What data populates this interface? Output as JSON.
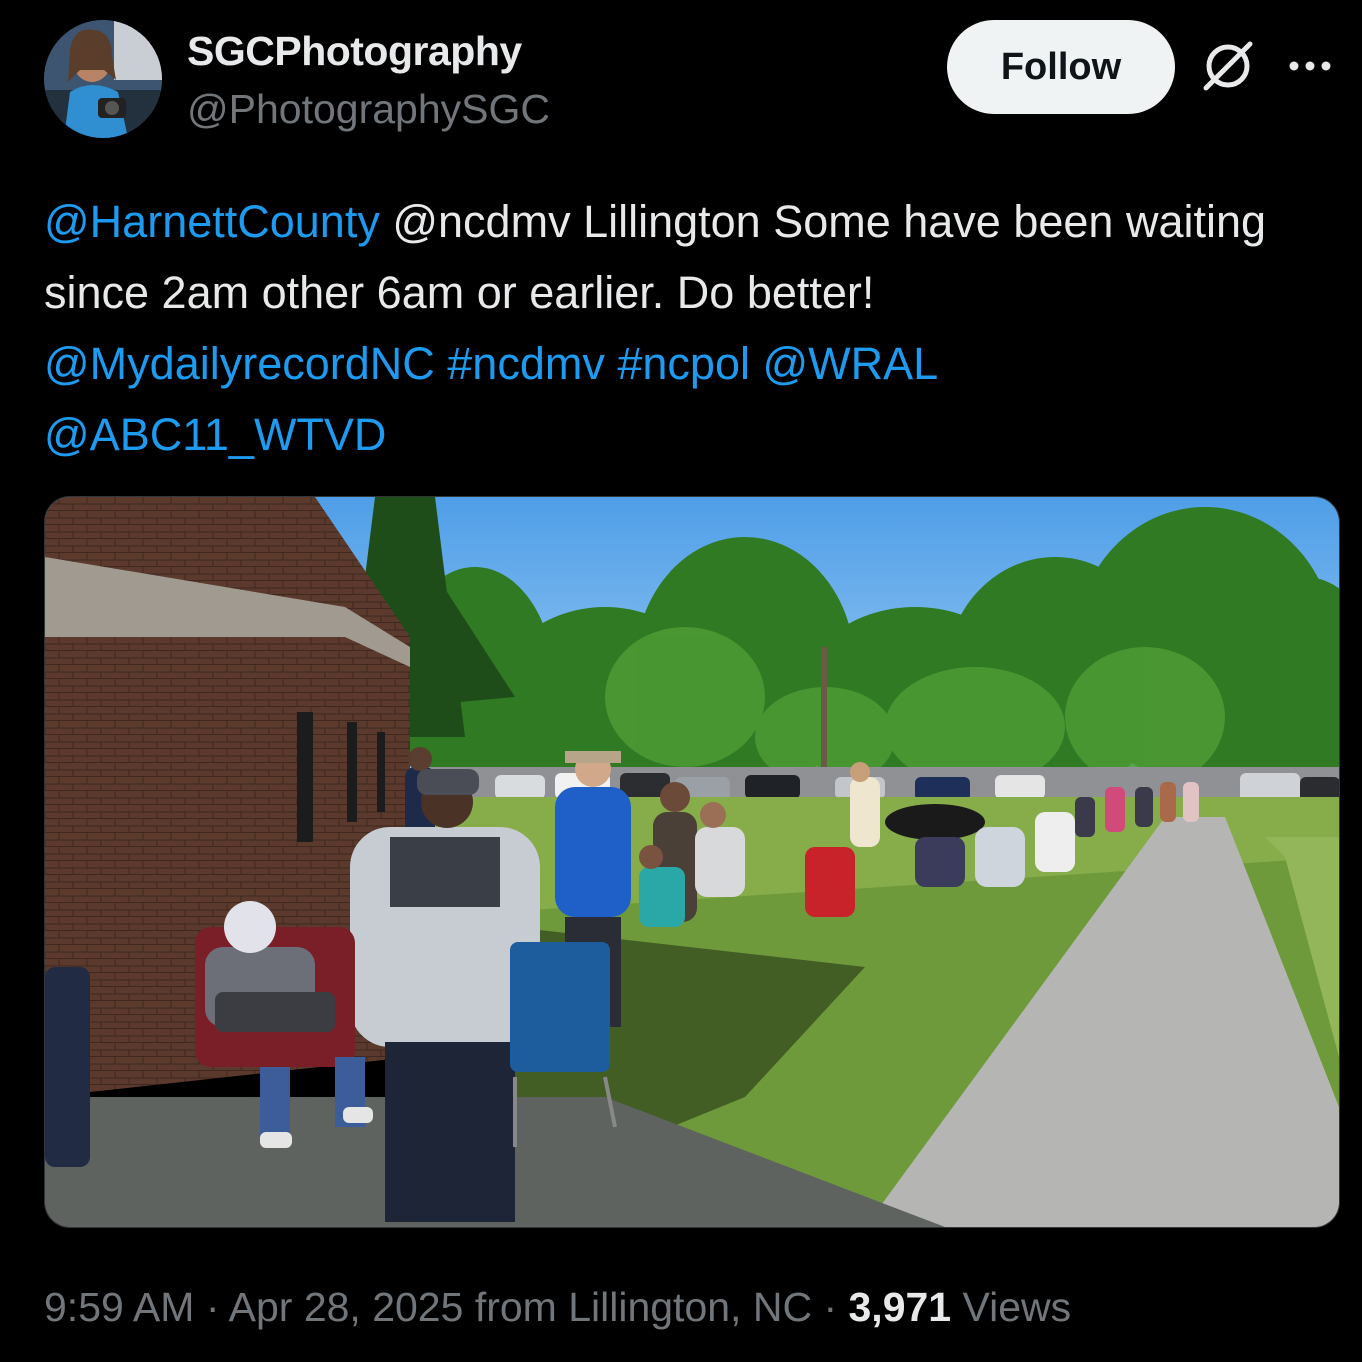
{
  "author": {
    "display_name": "SGCPhotography",
    "handle": "@PhotographySGC",
    "avatar_icon": "user-avatar"
  },
  "actions": {
    "follow_label": "Follow",
    "grok_icon": "grok-icon",
    "more_icon": "more-options-icon"
  },
  "tweet": {
    "mention1": "@HarnettCounty",
    "text1": " @ncdmv Lillington Some have been waiting since 2am other 6am or earlier. Do better! ",
    "mention2": "@MydailyrecordNC",
    "hashtag1": "#ncdmv",
    "hashtag2": "#ncpol",
    "mention3": "@WRAL",
    "mention4": "@ABC11_WTVD"
  },
  "media": {
    "type": "photo"
  },
  "meta": {
    "time": "9:59 AM",
    "date": "Apr 28, 2025",
    "location_text": "from Lillington, NC",
    "views_count": "3,971",
    "views_label": "Views"
  },
  "colors": {
    "background": "#000000",
    "link": "#1d9bf0",
    "secondary_text": "#71767b",
    "follow_bg": "#eff3f4"
  }
}
